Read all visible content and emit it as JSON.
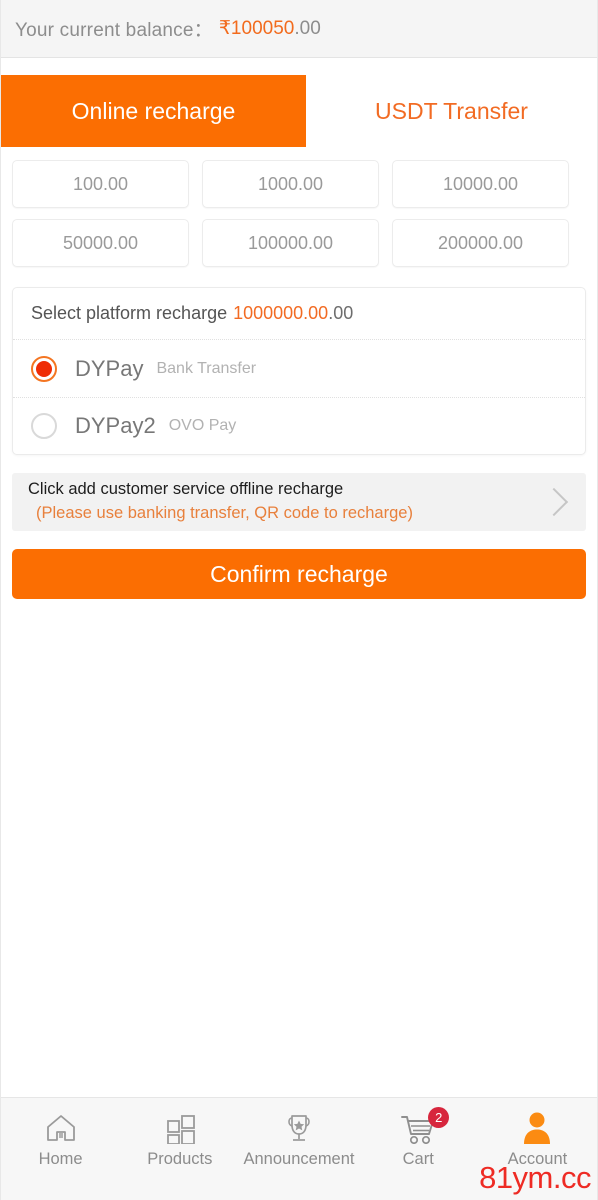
{
  "header": {
    "balance_label": "Your current balance：",
    "balance_amount": "₹100050",
    "balance_cents": ".00"
  },
  "tabs": [
    {
      "label": "Online recharge",
      "active": true
    },
    {
      "label": "USDT Transfer",
      "active": false
    }
  ],
  "amount_options": [
    {
      "label": "100.00"
    },
    {
      "label": "1000.00"
    },
    {
      "label": "10000.00"
    },
    {
      "label": "50000.00"
    },
    {
      "label": "100000.00"
    },
    {
      "label": "200000.00"
    }
  ],
  "platform": {
    "title": "Select platform recharge",
    "amount": "1000000.00",
    "cents": ".00",
    "methods": [
      {
        "name": "DYPay",
        "desc": "Bank Transfer",
        "selected": true
      },
      {
        "name": "DYPay2",
        "desc": "OVO Pay",
        "selected": false
      }
    ]
  },
  "service": {
    "line1": "Click add customer service offline recharge",
    "line2": "(Please use banking transfer, QR code to recharge)",
    "chevron": "chevron-right-icon"
  },
  "confirm": {
    "label": "Confirm recharge"
  },
  "bottom_nav": {
    "items": [
      {
        "label": "Home",
        "icon": "home-icon"
      },
      {
        "label": "Products",
        "icon": "grid-squares-icon"
      },
      {
        "label": "Announcement",
        "icon": "trophy-star-icon"
      },
      {
        "label": "Cart",
        "icon": "shopping-cart-icon",
        "badge": "2"
      },
      {
        "label": "Account",
        "icon": "user-person-icon"
      }
    ],
    "watermark": "81ym.cc"
  },
  "colors": {
    "accent_orange": "#fb6e02",
    "text_orange": "#f26b23",
    "radio_red": "#ef2c06",
    "badge_red": "#d7263d",
    "watermark_red": "#ee2b24",
    "muted_gray": "#8d8d8d",
    "panel_gray": "#f5f5f5"
  }
}
